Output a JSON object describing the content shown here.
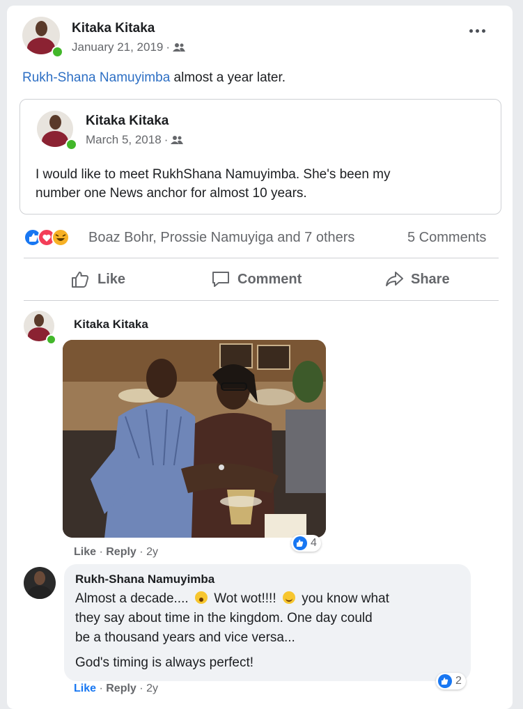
{
  "post": {
    "author": "Kitaka Kitaka",
    "date": "January 21, 2019",
    "privacy_icon": "friends-icon",
    "mention": "Rukh-Shana Namuyimba",
    "text_rest": " almost a year later.",
    "more_icon": "more-options-icon"
  },
  "shared": {
    "author": "Kitaka Kitaka",
    "date": "March 5, 2018",
    "line1": "I would like to meet RukhShana Namuyimba. She's been my",
    "line2": "number one News anchor for almost 10 years."
  },
  "reactions": {
    "summary": "Boaz Bohr, Prossie Namuyiga and 7 others",
    "comments": "5 Comments"
  },
  "actions": {
    "like": "Like",
    "comment": "Comment",
    "share": "Share"
  },
  "comment1": {
    "author": "Kitaka Kitaka",
    "like": "Like",
    "reply": "Reply",
    "age": "2y",
    "reaction_count": "4"
  },
  "comment2": {
    "author": "Rukh-Shana Namuyimba",
    "line1a": "Almost a decade....",
    "line1b": "Wot wot!!!!",
    "line1c": "you know what",
    "line2": "they say about time in the kingdom. One day could",
    "line3": "be a thousand years and vice versa...",
    "line4": "God's timing is always perfect!",
    "like": "Like",
    "reply": "Reply",
    "age": "2y",
    "reaction_count": "2"
  },
  "colors": {
    "accent": "#1877f2",
    "link": "#2d6fc4",
    "online": "#42b72a"
  }
}
